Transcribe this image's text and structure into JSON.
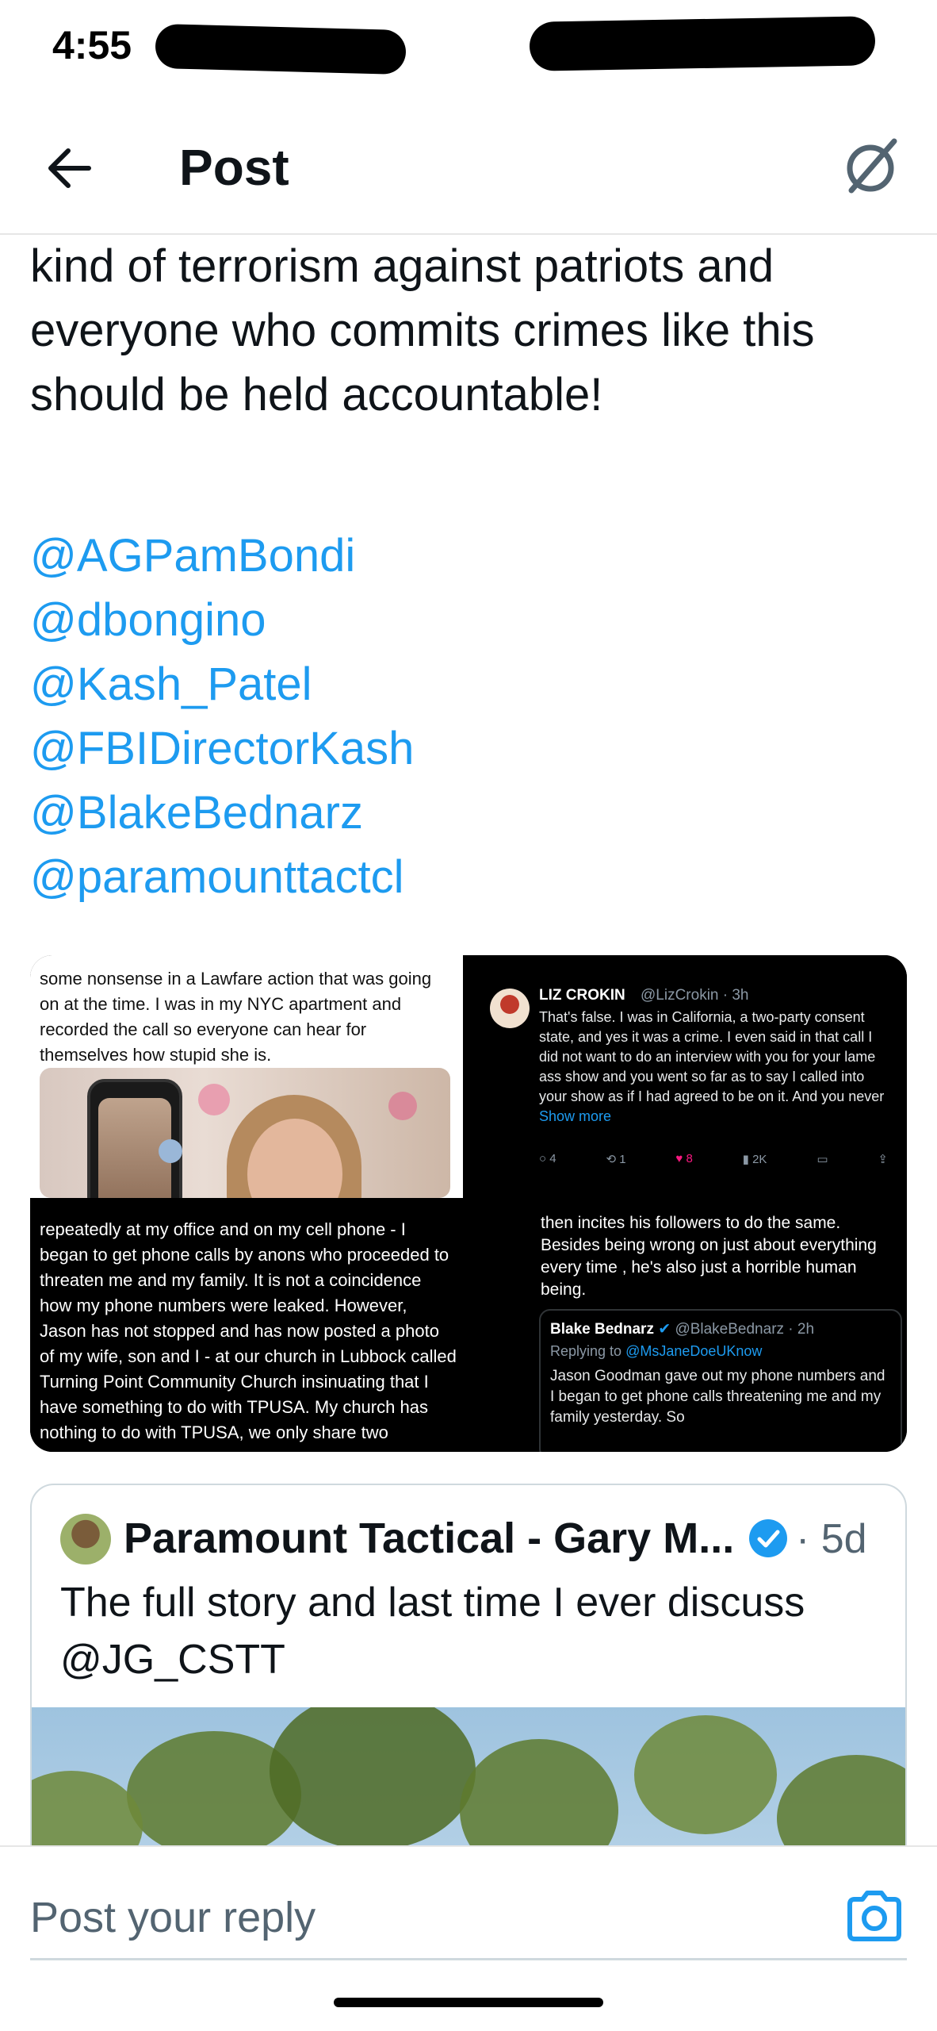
{
  "status_bar": {
    "time": "4:55"
  },
  "header": {
    "title": "Post",
    "back_icon": "arrow-left-icon",
    "grok_icon": "grok-icon"
  },
  "post": {
    "body": "There should be zero tolerance for this kind of terrorism against patriots and everyone who commits crimes like this should be held accountable!",
    "mentions": [
      "@AGPamBondi",
      "@dbongino",
      "@Kash_Patel",
      "@FBIDirectorKash",
      "@BlakeBednarz",
      "@paramounttactcl"
    ]
  },
  "media": {
    "top_left_text": "some nonsense in a Lawfare action that was going on at the time. I was in my NYC apartment and recorded the call so everyone can hear for themselves how stupid she is.",
    "top_right": {
      "name": "LIZ CROKIN",
      "handle": "@LizCrokin · 3h",
      "text": "That's false. I was in California, a two-party consent state, and yes it was a crime. I even said in that call I did not want to do an interview with you for your lame ass show and you went so far as to say I called into your show as if I had agreed to be on it. And you never",
      "show_more": "Show more",
      "replies": "4",
      "reposts": "1",
      "likes": "8",
      "views": "2K"
    },
    "bottom_left_text": "repeatedly at my office and on my cell phone - I began to get phone calls by anons who proceeded to threaten me and my family. It is not a coincidence how my phone numbers were leaked. However, Jason has not stopped and has now posted a photo of my wife, son and I - at our church in Lubbock called Turning Point Community Church insinuating that I have something to do with TPUSA. My church has nothing to do with TPUSA, we only share two",
    "bottom_right": {
      "text": "then incites his followers to do the same. Besides being wrong on just about everything every time , he's also just a horrible human being.",
      "quote_name": "Blake Bednarz",
      "quote_handle": "@BlakeBednarz · 2h",
      "quote_replying_label": "Replying to",
      "quote_replying_to": "@MsJaneDoeUKnow",
      "quote_text": "Jason Goodman gave out my phone numbers and I began to get phone calls threatening me and my family yesterday. So"
    }
  },
  "quoted_post": {
    "name": "Paramount Tactical - Gary M...",
    "time": "· 5d",
    "text": "The full story and last time I ever discuss @JG_CSTT",
    "verified_icon": "verified-badge-icon"
  },
  "reply": {
    "placeholder": "Post your reply",
    "camera_icon": "camera-icon"
  },
  "colors": {
    "link": "#1d9bf0",
    "text": "#0f1419",
    "secondary": "#536471",
    "like": "#f91880"
  }
}
